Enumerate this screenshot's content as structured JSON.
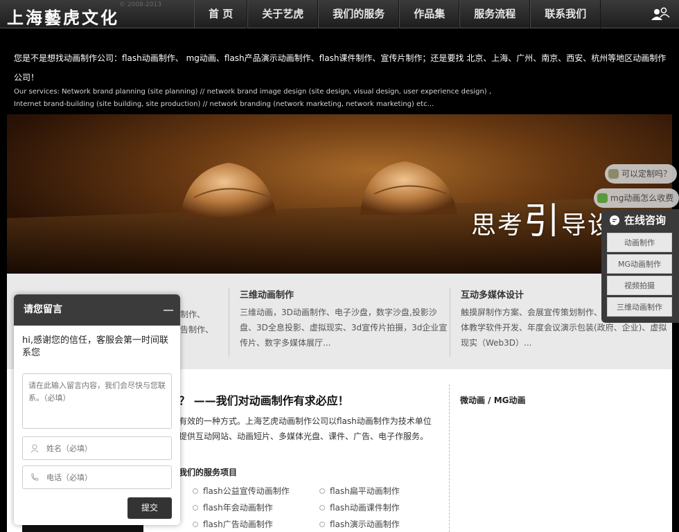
{
  "header": {
    "logo": "上海藝虎文化",
    "copyright": "© 2008-2013",
    "nav": [
      "首 页",
      "关于艺虎",
      "我们的服务",
      "作品集",
      "服务流程",
      "联系我们"
    ]
  },
  "intro": {
    "line": "您是不是想找动画制作公司：flash动画制作、 mg动画、flash产品演示动画制作、flash课件制作、宣传片制作；还是要找 北京、上海、广州、南京、西安、杭州等地区动画制作公司！",
    "services_en": "Our services: Network brand planning (site planning) // network brand image design (site design, visual design, user experience design) , Internet brand-building (site building, site production) // network branding (network marketing, network marketing) etc..."
  },
  "banner": {
    "text_a": "思考",
    "text_b": "引",
    "text_c": "导设计"
  },
  "features": [
    {
      "title": "",
      "desc": "制作、\n告制作、"
    },
    {
      "title": "三维动画制作",
      "desc": "三维动画，3D动画制作、电子沙盘，数字沙盘,投影沙盘、3D全息投影、虚拟现实、3d宣传片拍摄，3d企业宣传片、数字多媒体展厅..."
    },
    {
      "title": "互动多媒体设计",
      "desc": "触摸屏制作方案、会展宣传策划制作、多媒体演示、多媒体教学软件开发、年度会议演示包装(政府、企业)、虚拟现实（Web3D）..."
    }
  ],
  "main": {
    "title": "？ ——我们对动画制作有求必应！",
    "desc": "有效的一种方式。上海艺虎动画制作公司以flash动画制作为技术单位提供互动网站、动画短片、多媒体光盘、课件、广告、电子作服务。",
    "services_title": "我们的服务项目",
    "services_col1": [
      "flash公益宣传动画制作",
      "flash年会动画制作",
      "flash广告动画制作"
    ],
    "services_col2": [
      "flash扁平动画制作",
      "flash动画课件制作",
      "flash演示动画制作"
    ],
    "side_title": "微动画 / MG动画"
  },
  "message_box": {
    "title": "请您留言",
    "greeting": "hi,感谢您的信任，客服会第一时间联系您",
    "content_placeholder": "请在此输入留言内容，我们会尽快与您联系。（必填）",
    "name_placeholder": "姓名（必填）",
    "phone_placeholder": "电话（必填）",
    "submit": "提交"
  },
  "bubbles": [
    "可以定制吗？",
    "mg动画怎么收费"
  ],
  "consult": {
    "title": "在线咨询",
    "items": [
      "动画制作",
      "MG动画制作",
      "视频拍摄",
      "三维动画制作"
    ]
  },
  "colors": {
    "nav_bg": "#2a2a2a",
    "page_bg": "#000000",
    "panel_bg": "#3a3a3a",
    "bubble_icon": "#5a9a3a"
  }
}
